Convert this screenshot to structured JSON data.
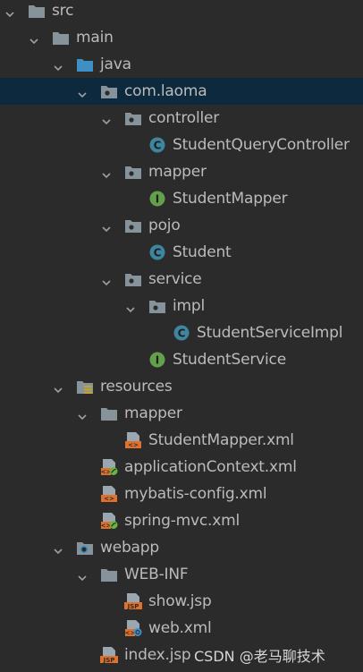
{
  "tree": [
    {
      "label": "src",
      "icon": "folder-icon",
      "expanded": true
    },
    {
      "label": "main",
      "icon": "folder-icon",
      "expanded": true
    },
    {
      "label": "java",
      "icon": "source-root-folder-icon",
      "expanded": true
    },
    {
      "label": "com.laoma",
      "icon": "package-icon",
      "expanded": true,
      "selected": true
    },
    {
      "label": "controller",
      "icon": "package-icon",
      "expanded": true
    },
    {
      "label": "StudentQueryController",
      "icon": "class-icon",
      "expanded": null
    },
    {
      "label": "mapper",
      "icon": "package-icon",
      "expanded": true
    },
    {
      "label": "StudentMapper",
      "icon": "interface-icon",
      "expanded": null
    },
    {
      "label": "pojo",
      "icon": "package-icon",
      "expanded": true
    },
    {
      "label": "Student",
      "icon": "class-icon",
      "expanded": null
    },
    {
      "label": "service",
      "icon": "package-icon",
      "expanded": true
    },
    {
      "label": "impl",
      "icon": "package-icon",
      "expanded": true
    },
    {
      "label": "StudentServiceImpl",
      "icon": "class-icon",
      "expanded": null
    },
    {
      "label": "StudentService",
      "icon": "interface-icon",
      "expanded": null
    },
    {
      "label": "resources",
      "icon": "resources-folder-icon",
      "expanded": true
    },
    {
      "label": "mapper",
      "icon": "folder-icon",
      "expanded": true
    },
    {
      "label": "StudentMapper.xml",
      "icon": "xml-file-icon",
      "expanded": null
    },
    {
      "label": "applicationContext.xml",
      "icon": "spring-xml-file-icon",
      "expanded": null
    },
    {
      "label": "mybatis-config.xml",
      "icon": "xml-file-icon",
      "expanded": null
    },
    {
      "label": "spring-mvc.xml",
      "icon": "spring-xml-file-icon",
      "expanded": null
    },
    {
      "label": "webapp",
      "icon": "web-folder-icon",
      "expanded": true
    },
    {
      "label": "WEB-INF",
      "icon": "folder-icon",
      "expanded": true
    },
    {
      "label": "show.jsp",
      "icon": "jsp-file-icon",
      "expanded": null
    },
    {
      "label": "web.xml",
      "icon": "web-xml-file-icon",
      "expanded": null
    },
    {
      "label": "index.jsp",
      "icon": "jsp-file-icon",
      "expanded": null
    }
  ],
  "watermark": "CSDN @老马聊技术",
  "colors": {
    "background": "#2b2b2b",
    "selection": "#0d293e",
    "text": "#bbbbbb",
    "folder": "#87939a",
    "source_root": "#3d8fc6",
    "class": "#3e86a0",
    "interface": "#62a04b",
    "xml": "#e0712c",
    "spring": "#6db33f"
  }
}
